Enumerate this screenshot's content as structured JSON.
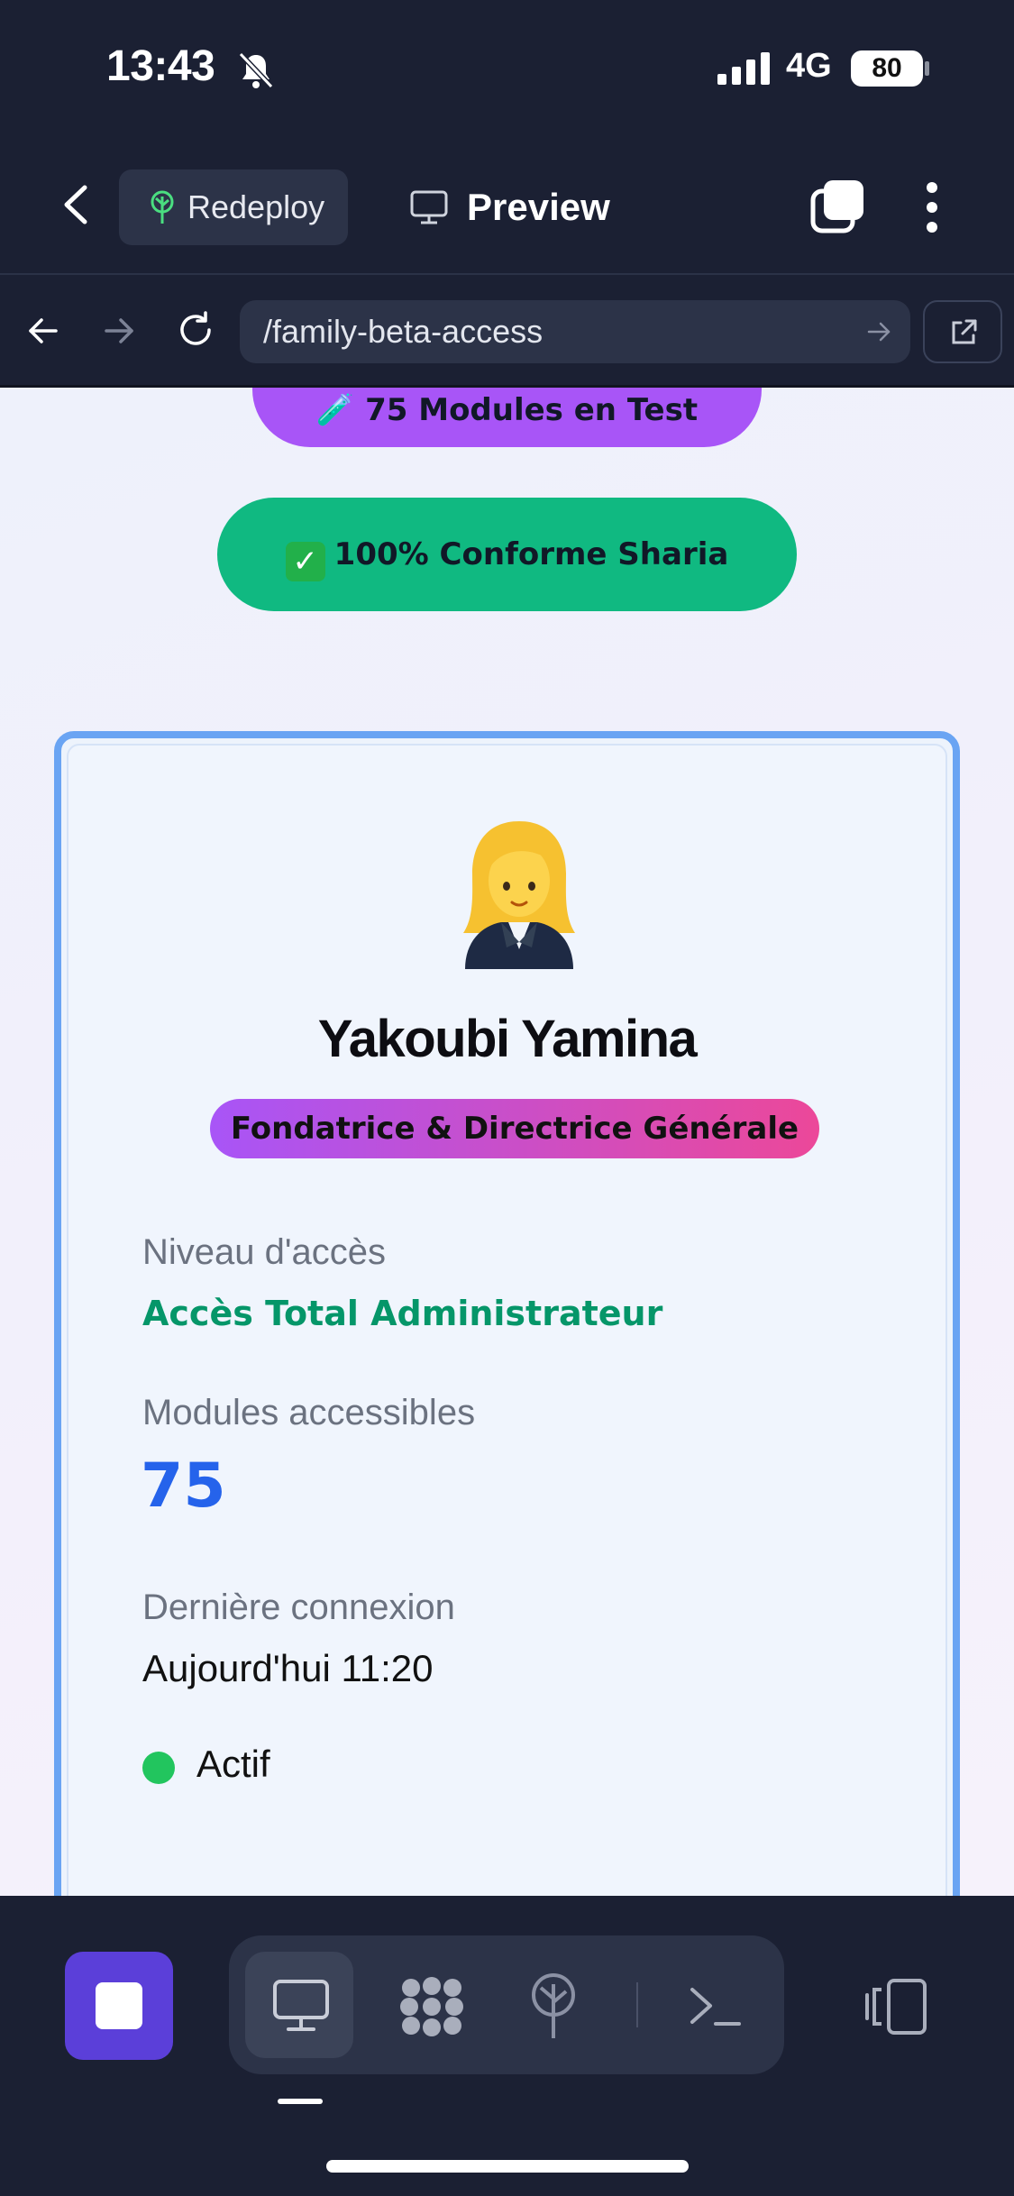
{
  "status_bar": {
    "time": "13:43",
    "network": "4G",
    "battery": "80"
  },
  "header": {
    "redeploy_label": "Redeploy",
    "preview_label": "Preview"
  },
  "browser": {
    "url": "/family-beta-access"
  },
  "content": {
    "pill_tests": "🧪 75 Modules en Test",
    "pill_sharia": "100% Conforme Sharia",
    "profile": {
      "name": "Yakoubi Yamina",
      "role": "Fondatrice & Directrice Générale",
      "access_label": "Niveau d'accès",
      "access_value": "Accès Total Administrateur",
      "modules_label": "Modules accessibles",
      "modules_value": "75",
      "login_label": "Dernière connexion",
      "login_value": "Aujourd'hui 11:20",
      "status": "Actif"
    }
  },
  "colors": {
    "accent_purple": "#a855f7",
    "accent_green": "#10b981",
    "card_border": "#6aa4f3",
    "status_active": "#22c55e",
    "modules_blue": "#2563eb"
  },
  "icons": [
    "bell-slash-icon",
    "signal-icon",
    "back-chevron-icon",
    "tree-icon",
    "monitor-icon",
    "tabs-icon",
    "more-vertical-icon",
    "arrow-left-icon",
    "arrow-right-icon",
    "reload-icon",
    "external-link-icon",
    "stop-icon",
    "agents-icon",
    "deploy-icon",
    "shell-icon",
    "devices-icon"
  ]
}
